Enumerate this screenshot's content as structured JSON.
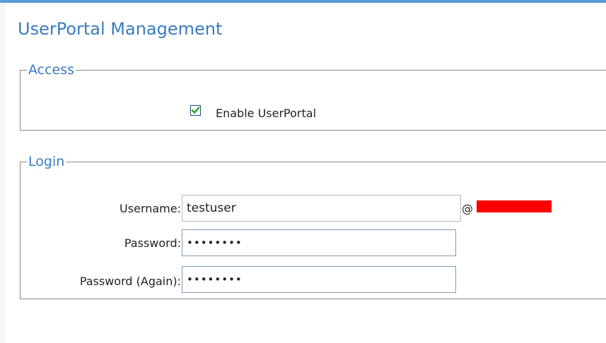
{
  "page": {
    "title": "UserPortal Management"
  },
  "access": {
    "legend": "Access",
    "enable_checkbox": {
      "label": "Enable UserPortal",
      "checked": true
    }
  },
  "login": {
    "legend": "Login",
    "username": {
      "label": "Username:",
      "value": "testuser",
      "domain_prefix": "@"
    },
    "password": {
      "label": "Password:",
      "value": "••••••••"
    },
    "password_again": {
      "label": "Password (Again):",
      "value": "••••••••"
    }
  },
  "colors": {
    "accent": "#3a7cc0",
    "redaction": "#ff0000"
  }
}
